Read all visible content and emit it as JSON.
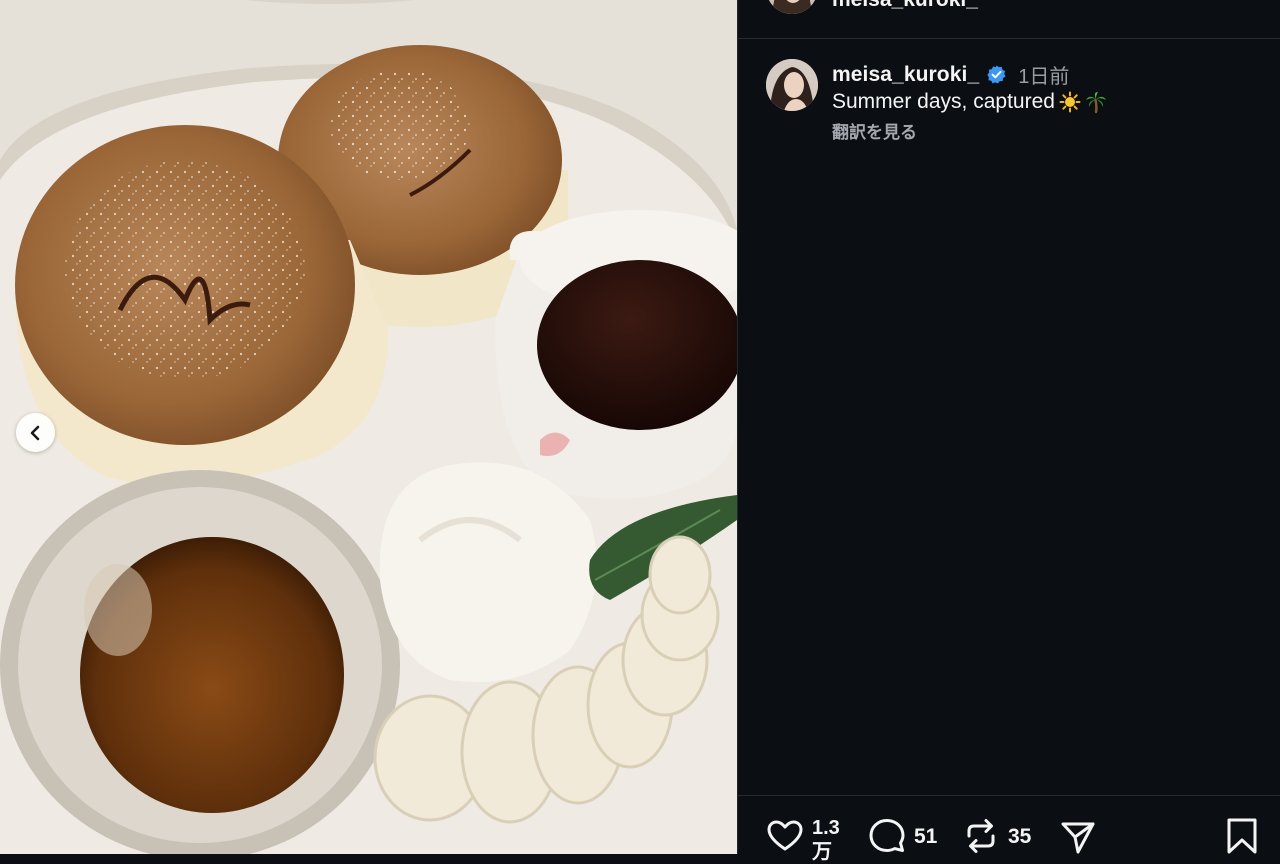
{
  "post": {
    "username": "meisa_kuroki_",
    "time_ago": "1日前",
    "caption": "Summer days, captured",
    "caption_emojis": [
      "sun-emoji",
      "palm-tree-emoji"
    ],
    "translate_label": "翻訳を見る"
  },
  "top_strip": {
    "partial_username": "meisa_kuroki_"
  },
  "actions": {
    "likes_line1": "1.3",
    "likes_line2": "万",
    "comments": "51",
    "reposts": "35"
  },
  "icons": {
    "like": "heart-icon",
    "comment": "comment-icon",
    "repost": "repost-icon",
    "share": "share-icon",
    "save": "bookmark-icon",
    "prev": "chevron-left-icon",
    "verified": "verified-badge-icon"
  },
  "colors": {
    "background": "#0b0f14",
    "verified_blue": "#3b97f0",
    "text": "#f4f4f4",
    "muted": "#9a9ea4"
  }
}
